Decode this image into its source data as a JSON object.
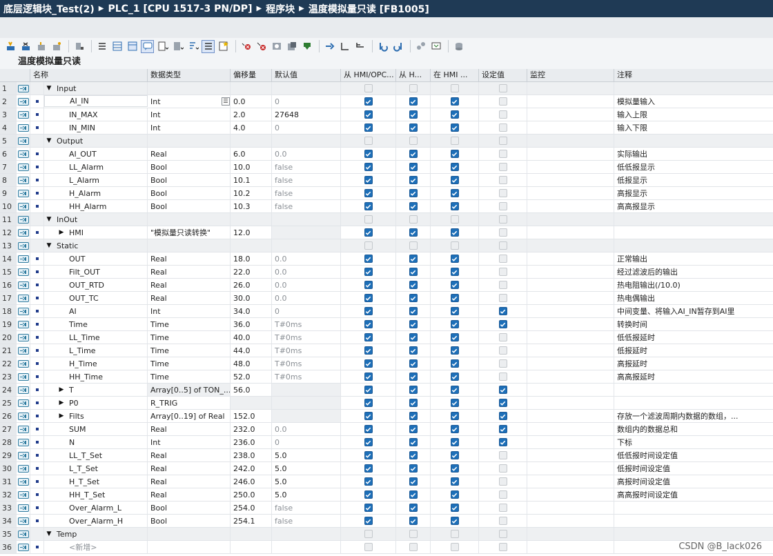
{
  "breadcrumb": [
    "底层逻辑块_Test(2)",
    "PLC_1 [CPU 1517-3 PN/DP]",
    "程序块",
    "温度模拟量只读 [FB1005]"
  ],
  "block_title": "温度模拟量只读",
  "columns": {
    "name": "名称",
    "type": "数据类型",
    "offset": "偏移量",
    "default": "默认值",
    "hmi_opc": "从 HMI/OPC...",
    "hmi_h": "从 H...",
    "in_hmi": "在 HMI ...",
    "setpoint": "设定值",
    "monitor": "监控",
    "comment": "注释"
  },
  "watermark": "CSDN @B_lack026",
  "colors": {
    "title_bg": "#1f3a55",
    "checkbox_on": "#1d6fb8"
  },
  "rows": [
    {
      "num": "1",
      "kind": "section",
      "tri": "down",
      "name": "Input",
      "type": "",
      "offset": "",
      "def": "",
      "c1": "dis",
      "c2": "dis",
      "c3": "dis",
      "c4": "dis",
      "comment": ""
    },
    {
      "num": "2",
      "kind": "var",
      "name": "AI_IN",
      "type": "Int",
      "offset": "0.0",
      "def": "0",
      "c1": "on",
      "c2": "on",
      "c3": "on",
      "c4": "dis",
      "comment": "模拟量输入",
      "selected": true
    },
    {
      "num": "3",
      "kind": "var",
      "name": "IN_MAX",
      "type": "Int",
      "offset": "2.0",
      "def": "27648",
      "defDark": true,
      "c1": "on",
      "c2": "on",
      "c3": "on",
      "c4": "dis",
      "comment": "输入上限"
    },
    {
      "num": "4",
      "kind": "var",
      "name": "IN_MIN",
      "type": "Int",
      "offset": "4.0",
      "def": "0",
      "c1": "on",
      "c2": "on",
      "c3": "on",
      "c4": "dis",
      "comment": "输入下限"
    },
    {
      "num": "5",
      "kind": "section",
      "tri": "down",
      "name": "Output",
      "type": "",
      "offset": "",
      "def": "",
      "c1": "dis",
      "c2": "dis",
      "c3": "dis",
      "c4": "dis",
      "comment": ""
    },
    {
      "num": "6",
      "kind": "var",
      "name": "AI_OUT",
      "type": "Real",
      "offset": "6.0",
      "def": "0.0",
      "c1": "on",
      "c2": "on",
      "c3": "on",
      "c4": "dis",
      "comment": "实际输出"
    },
    {
      "num": "7",
      "kind": "var",
      "name": "LL_Alarm",
      "type": "Bool",
      "offset": "10.0",
      "def": "false",
      "c1": "on",
      "c2": "on",
      "c3": "on",
      "c4": "dis",
      "comment": "低低报显示"
    },
    {
      "num": "8",
      "kind": "var",
      "name": "L_Alarm",
      "type": "Bool",
      "offset": "10.1",
      "def": "false",
      "c1": "on",
      "c2": "on",
      "c3": "on",
      "c4": "dis",
      "comment": "低报显示"
    },
    {
      "num": "9",
      "kind": "var",
      "name": "H_Alarm",
      "type": "Bool",
      "offset": "10.2",
      "def": "false",
      "c1": "on",
      "c2": "on",
      "c3": "on",
      "c4": "dis",
      "comment": "高报显示"
    },
    {
      "num": "10",
      "kind": "var",
      "name": "HH_Alarm",
      "type": "Bool",
      "offset": "10.3",
      "def": "false",
      "c1": "on",
      "c2": "on",
      "c3": "on",
      "c4": "dis",
      "comment": "高高报显示"
    },
    {
      "num": "11",
      "kind": "section",
      "tri": "down",
      "name": "InOut",
      "type": "",
      "offset": "",
      "def": "",
      "c1": "dis",
      "c2": "dis",
      "c3": "dis",
      "c4": "dis",
      "comment": ""
    },
    {
      "num": "12",
      "kind": "var",
      "tri": "right",
      "name": "HMI",
      "type": "\"模拟量只读转换\"",
      "offset": "12.0",
      "def": "",
      "grayDef": true,
      "c1": "on",
      "c2": "on",
      "c3": "on",
      "c4": "dis",
      "comment": ""
    },
    {
      "num": "13",
      "kind": "section",
      "tri": "down",
      "name": "Static",
      "type": "",
      "offset": "",
      "def": "",
      "c1": "dis",
      "c2": "dis",
      "c3": "dis",
      "c4": "dis",
      "comment": ""
    },
    {
      "num": "14",
      "kind": "var",
      "name": "OUT",
      "type": "Real",
      "offset": "18.0",
      "def": "0.0",
      "c1": "on",
      "c2": "on",
      "c3": "on",
      "c4": "dis",
      "comment": "正常输出"
    },
    {
      "num": "15",
      "kind": "var",
      "name": "Filt_OUT",
      "type": "Real",
      "offset": "22.0",
      "def": "0.0",
      "c1": "on",
      "c2": "on",
      "c3": "on",
      "c4": "dis",
      "comment": "经过滤波后的输出"
    },
    {
      "num": "16",
      "kind": "var",
      "name": "OUT_RTD",
      "type": "Real",
      "offset": "26.0",
      "def": "0.0",
      "c1": "on",
      "c2": "on",
      "c3": "on",
      "c4": "dis",
      "comment": "热电阻输出(/10.0)"
    },
    {
      "num": "17",
      "kind": "var",
      "name": "OUT_TC",
      "type": "Real",
      "offset": "30.0",
      "def": "0.0",
      "c1": "on",
      "c2": "on",
      "c3": "on",
      "c4": "dis",
      "comment": "热电偶输出"
    },
    {
      "num": "18",
      "kind": "var",
      "name": "AI",
      "type": "Int",
      "offset": "34.0",
      "def": "0",
      "c1": "on",
      "c2": "on",
      "c3": "on",
      "c4": "on",
      "comment": "中间变量、将输入AI_IN暂存到AI里"
    },
    {
      "num": "19",
      "kind": "var",
      "name": "Time",
      "type": "Time",
      "offset": "36.0",
      "def": "T#0ms",
      "c1": "on",
      "c2": "on",
      "c3": "on",
      "c4": "on",
      "comment": "转换时间"
    },
    {
      "num": "20",
      "kind": "var",
      "name": "LL_Time",
      "type": "Time",
      "offset": "40.0",
      "def": "T#0ms",
      "c1": "on",
      "c2": "on",
      "c3": "on",
      "c4": "dis",
      "comment": "低低报延时"
    },
    {
      "num": "21",
      "kind": "var",
      "name": "L_Time",
      "type": "Time",
      "offset": "44.0",
      "def": "T#0ms",
      "c1": "on",
      "c2": "on",
      "c3": "on",
      "c4": "dis",
      "comment": "低报延时"
    },
    {
      "num": "22",
      "kind": "var",
      "name": "H_Time",
      "type": "Time",
      "offset": "48.0",
      "def": "T#0ms",
      "c1": "on",
      "c2": "on",
      "c3": "on",
      "c4": "dis",
      "comment": "高报延时"
    },
    {
      "num": "23",
      "kind": "var",
      "name": "HH_Time",
      "type": "Time",
      "offset": "52.0",
      "def": "T#0ms",
      "c1": "on",
      "c2": "on",
      "c3": "on",
      "c4": "dis",
      "comment": "高高报延时"
    },
    {
      "num": "24",
      "kind": "var",
      "tri": "right",
      "name": "T",
      "type": "Array[0..5] of TON_...",
      "offset": "56.0",
      "def": "",
      "grayDef": true,
      "grayType": true,
      "c1": "on",
      "c2": "on",
      "c3": "on",
      "c4": "on",
      "comment": ""
    },
    {
      "num": "25",
      "kind": "var",
      "tri": "right",
      "name": "P0",
      "type": "R_TRIG",
      "offset": "",
      "def": "",
      "grayDef": true,
      "grayOff": true,
      "c1": "on",
      "c2": "on",
      "c3": "on",
      "c4": "on",
      "comment": ""
    },
    {
      "num": "26",
      "kind": "var",
      "tri": "right",
      "name": "Filts",
      "type": "Array[0..19] of Real",
      "offset": "152.0",
      "def": "",
      "grayDef": true,
      "c1": "on",
      "c2": "on",
      "c3": "on",
      "c4": "on",
      "comment": "存放一个滤波周期内数据的数组，..."
    },
    {
      "num": "27",
      "kind": "var",
      "name": "SUM",
      "type": "Real",
      "offset": "232.0",
      "def": "0.0",
      "c1": "on",
      "c2": "on",
      "c3": "on",
      "c4": "on",
      "comment": "数组内的数据总和"
    },
    {
      "num": "28",
      "kind": "var",
      "name": "N",
      "type": "Int",
      "offset": "236.0",
      "def": "0",
      "c1": "on",
      "c2": "on",
      "c3": "on",
      "c4": "on",
      "comment": "下标"
    },
    {
      "num": "29",
      "kind": "var",
      "name": "LL_T_Set",
      "type": "Real",
      "offset": "238.0",
      "def": "5.0",
      "defDark": true,
      "c1": "on",
      "c2": "on",
      "c3": "on",
      "c4": "dis",
      "comment": "低低报时间设定值"
    },
    {
      "num": "30",
      "kind": "var",
      "name": "L_T_Set",
      "type": "Real",
      "offset": "242.0",
      "def": "5.0",
      "defDark": true,
      "c1": "on",
      "c2": "on",
      "c3": "on",
      "c4": "dis",
      "comment": "低报时间设定值"
    },
    {
      "num": "31",
      "kind": "var",
      "name": "H_T_Set",
      "type": "Real",
      "offset": "246.0",
      "def": "5.0",
      "defDark": true,
      "c1": "on",
      "c2": "on",
      "c3": "on",
      "c4": "dis",
      "comment": "高报时间设定值"
    },
    {
      "num": "32",
      "kind": "var",
      "name": "HH_T_Set",
      "type": "Real",
      "offset": "250.0",
      "def": "5.0",
      "defDark": true,
      "c1": "on",
      "c2": "on",
      "c3": "on",
      "c4": "dis",
      "comment": "高高报时间设定值"
    },
    {
      "num": "33",
      "kind": "var",
      "name": "Over_Alarm_L",
      "type": "Bool",
      "offset": "254.0",
      "def": "false",
      "c1": "on",
      "c2": "on",
      "c3": "on",
      "c4": "dis",
      "comment": ""
    },
    {
      "num": "34",
      "kind": "var",
      "name": "Over_Alarm_H",
      "type": "Bool",
      "offset": "254.1",
      "def": "false",
      "c1": "on",
      "c2": "on",
      "c3": "on",
      "c4": "dis",
      "comment": ""
    },
    {
      "num": "35",
      "kind": "section",
      "tri": "down",
      "name": "Temp",
      "type": "",
      "offset": "",
      "def": "",
      "c1": "dis",
      "c2": "dis",
      "c3": "dis",
      "c4": "dis",
      "comment": ""
    },
    {
      "num": "36",
      "kind": "new",
      "name": "<新增>",
      "type": "",
      "offset": "",
      "def": "",
      "c1": "dis",
      "c2": "dis",
      "c3": "dis",
      "c4": "dis",
      "comment": ""
    }
  ]
}
